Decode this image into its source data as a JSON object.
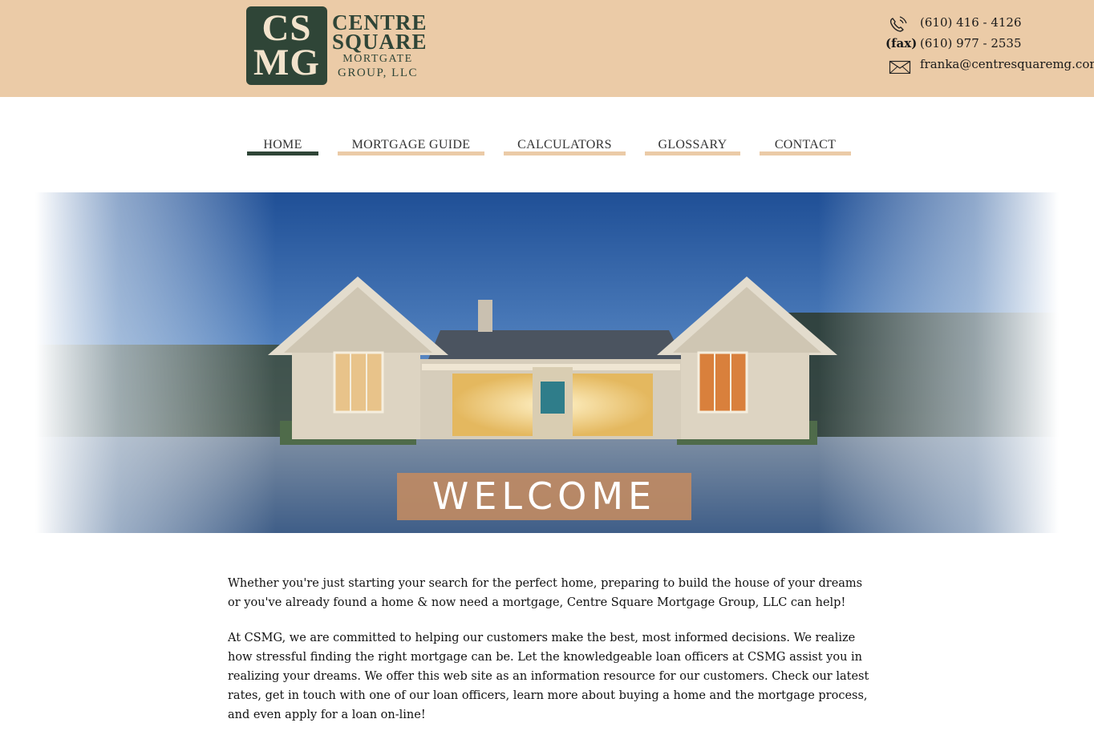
{
  "brand": {
    "monogram_top": "CS",
    "monogram_bottom": "MG",
    "name_line1": "CENTRE",
    "name_line2": "SQUARE",
    "name_line3": "MORTGATE",
    "name_line4": "GROUP, LLC",
    "colors": {
      "dark_green": "#2f4537",
      "tan": "#ebcba7",
      "welcome_bg": "#bf8a63"
    }
  },
  "contact": {
    "phone": "(610) 416 - 4126",
    "fax_label": "(fax)",
    "fax": "(610) 977 - 2535",
    "email": "franka@centresquaremg.com",
    "icons": {
      "phone": "phone-icon",
      "email": "envelope-icon"
    }
  },
  "nav": {
    "items": [
      {
        "label": "HOME",
        "active": true
      },
      {
        "label": "MORTGAGE GUIDE",
        "active": false
      },
      {
        "label": "CALCULATORS",
        "active": false
      },
      {
        "label": "GLOSSARY",
        "active": false
      },
      {
        "label": "CONTACT",
        "active": false
      }
    ]
  },
  "hero": {
    "banner_text": "WELCOME"
  },
  "content": {
    "paragraph1": "Whether you're just starting your search for the perfect home, preparing to build the house of your dreams or you've already found a home & now need a mortgage, Centre Square Mortgage Group, LLC can help!",
    "paragraph2": "At CSMG, we are committed to helping our customers make the best, most informed decisions. We realize how stressful finding the right mortgage can be. Let the knowledgeable loan officers at CSMG assist you in realizing your dreams. We offer this web site as an information resource for our customers. Check our latest rates, get in touch with one of our loan officers, learn more about buying a home and the mortgage process, and even apply for a loan on-line!"
  }
}
